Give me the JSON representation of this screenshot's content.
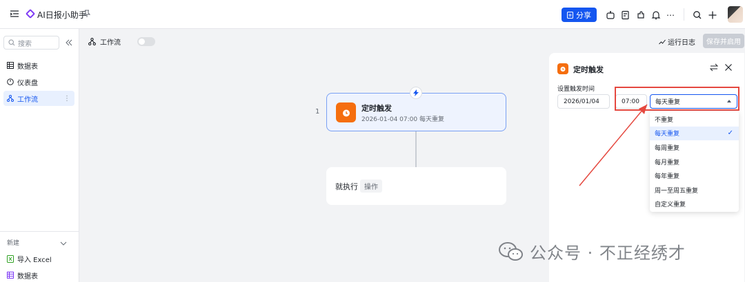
{
  "header": {
    "app_title": "AI日报小助手",
    "share_label": "分享"
  },
  "sidebar": {
    "search_placeholder": "搜索",
    "items": [
      {
        "label": "数据表"
      },
      {
        "label": "仪表盘"
      },
      {
        "label": "工作流"
      }
    ],
    "new_section_label": "新建",
    "new_items": [
      {
        "label": "导入 Excel"
      },
      {
        "label": "数据表"
      }
    ]
  },
  "workspace": {
    "title": "工作流",
    "run_log_label": "运行日志",
    "save_label": "保存并启用"
  },
  "flow": {
    "step_number": "1",
    "trigger_title": "定时触发",
    "trigger_subtitle": "2026-01-04 07:00 每天重复",
    "action_label": "就执行",
    "action_tag": "操作"
  },
  "panel": {
    "title": "定时触发",
    "field_label": "设置触发时间",
    "date_value": "2026/01/04",
    "time_value": "07:00",
    "repeat_value": "每天重复",
    "options": [
      "不重复",
      "每天重复",
      "每周重复",
      "每月重复",
      "每年重复",
      "周一至周五重复",
      "自定义重复"
    ],
    "selected_index": 1
  },
  "watermark": {
    "text": "公众号 · 不正经绣才"
  },
  "colors": {
    "primary": "#1456f0",
    "trigger_orange": "#f56e0f",
    "highlight_red": "#e5483f"
  }
}
